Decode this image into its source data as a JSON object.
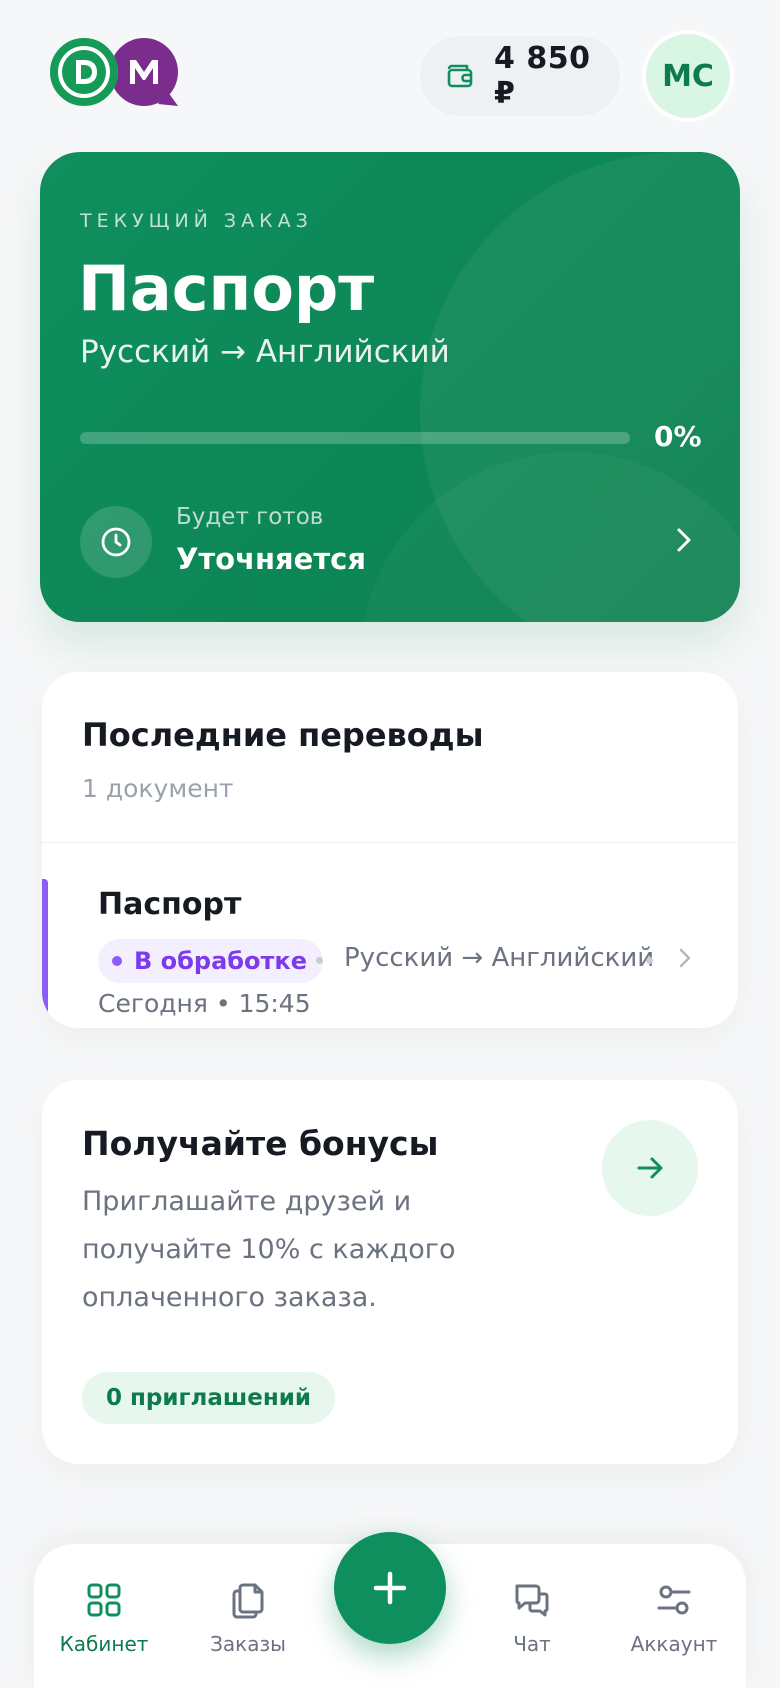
{
  "header": {
    "logo_letters": "DM",
    "balance": "4 850 ₽",
    "avatar_initials": "МС"
  },
  "current_order": {
    "label": "ТЕКУЩИЙ ЗАКАЗ",
    "title": "Паспорт",
    "languages": "Русский → Английский",
    "progress_percent": 0,
    "progress_text": "0%",
    "ready_label": "Будет готов",
    "ready_value": "Уточняется"
  },
  "recent": {
    "title": "Последние переводы",
    "subtitle": "1 документ",
    "items": [
      {
        "document": "Паспорт",
        "status": "В обработке",
        "languages": "Русский → Английский",
        "date": "Сегодня • 15:45"
      }
    ]
  },
  "bonus": {
    "title": "Получайте бонусы",
    "text": "Приглашайте друзей и получайте 10% с каждого оплаченного заказа.",
    "invites": "0 приглашений"
  },
  "nav": {
    "items": [
      {
        "label": "Кабинет",
        "icon": "grid-icon",
        "active": true
      },
      {
        "label": "Заказы",
        "icon": "documents-icon",
        "active": false
      },
      {
        "label": "Чат",
        "icon": "chat-icon",
        "active": false
      },
      {
        "label": "Аккаунт",
        "icon": "sliders-icon",
        "active": false
      }
    ]
  },
  "colors": {
    "brand_green": "#0f8f5e",
    "brand_purple": "#7b2d8e",
    "status_purple": "#7c3aed"
  }
}
